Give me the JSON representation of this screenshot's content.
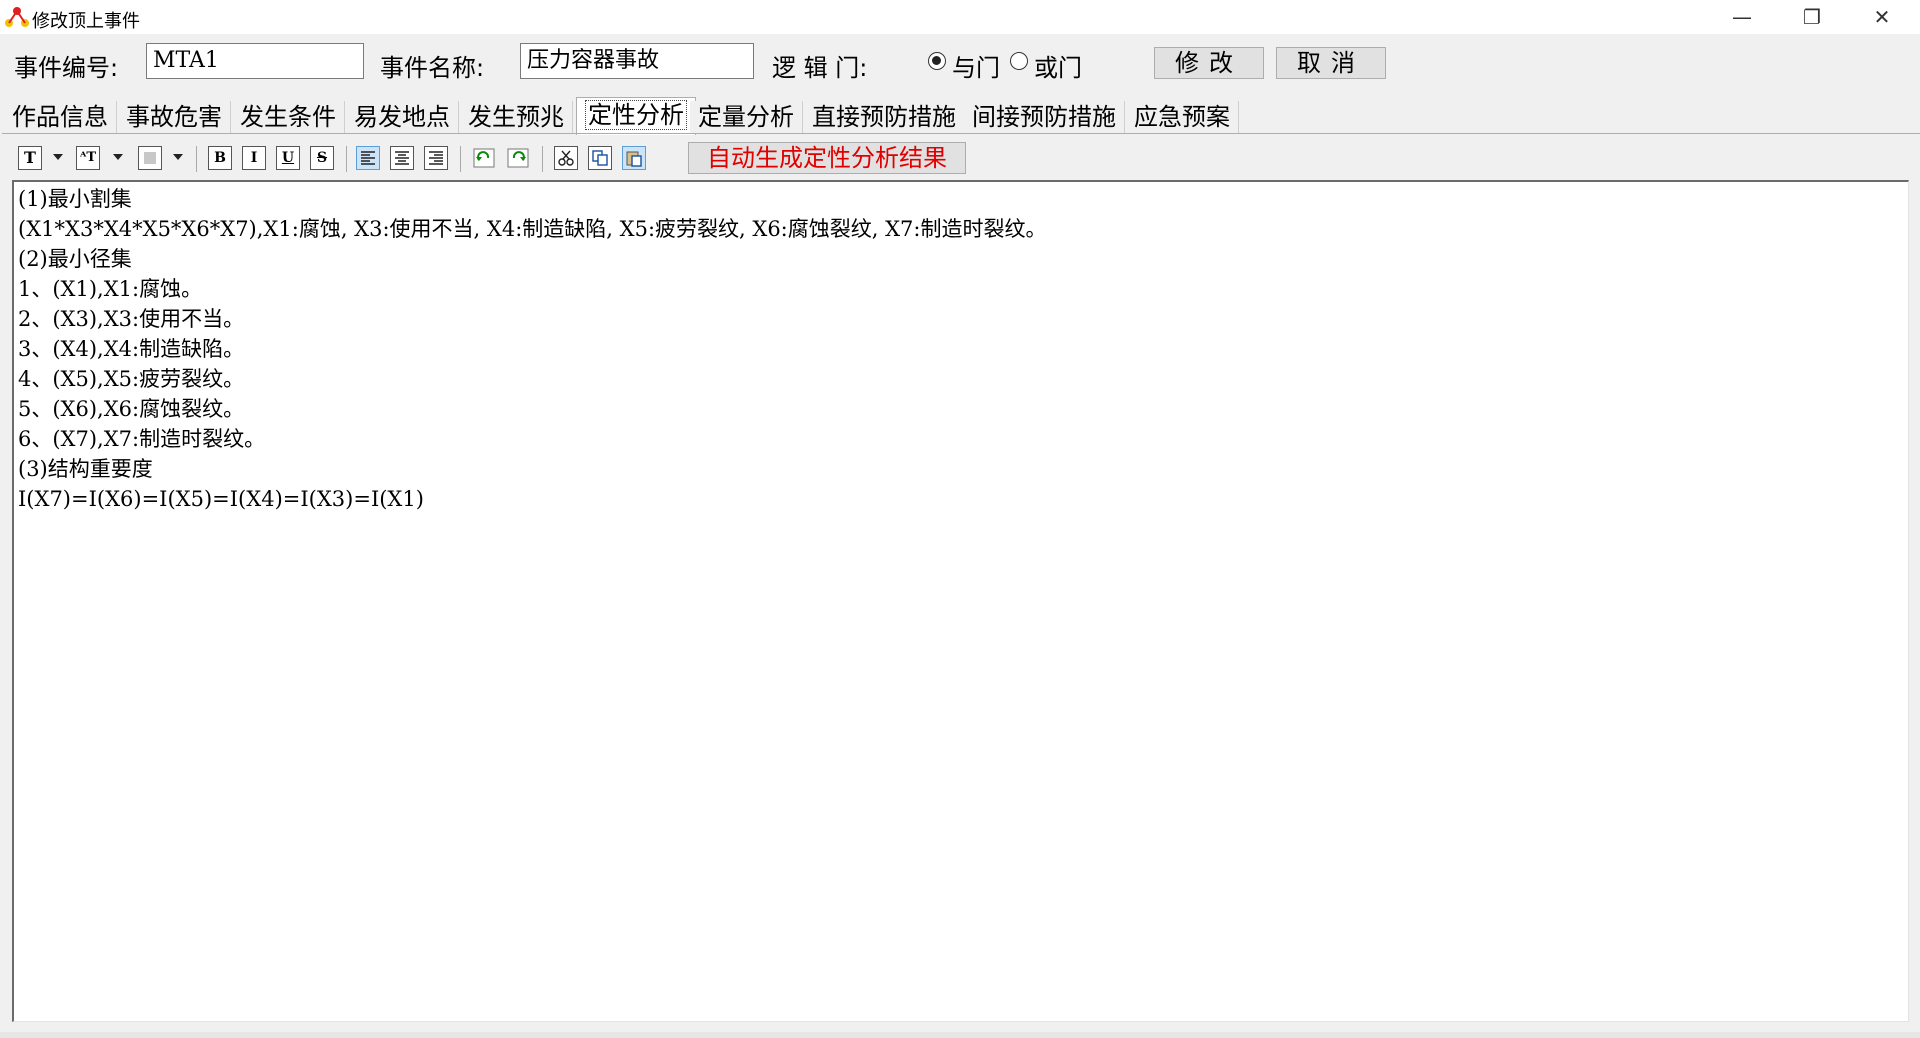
{
  "window": {
    "title": "修改顶上事件",
    "controls": {
      "minimize": "—",
      "maximize": "❐",
      "close": "✕"
    }
  },
  "header": {
    "event_no_label": "事件编号:",
    "event_no_value": "MTA1",
    "event_name_label": "事件名称:",
    "event_name_value": "压力容器事故",
    "logic_gate_label": "逻 辑 门:",
    "gate_and": "与门",
    "gate_or": "或门",
    "selected_gate": "与门",
    "modify_button": "修改",
    "cancel_button": "取消"
  },
  "tabs": [
    "作品信息",
    "事故危害",
    "发生条件",
    "易发地点",
    "发生预兆",
    "定性分析",
    "定量分析",
    "直接预防措施",
    "间接预防措施",
    "应急预案"
  ],
  "active_tab": "定性分析",
  "toolbar": {
    "icons": [
      "font-icon",
      "font-size-icon",
      "color-icon",
      "bold-icon",
      "italic-icon",
      "underline-icon",
      "strikethrough-icon",
      "align-left-icon",
      "align-center-icon",
      "align-right-icon",
      "undo-icon",
      "redo-icon",
      "cut-icon",
      "copy-icon",
      "paste-icon"
    ],
    "generate_button": "自动生成定性分析结果",
    "generate_color": "#e00000"
  },
  "editor": {
    "lines": [
      "(1)最小割集",
      "(X1*X3*X4*X5*X6*X7),X1:腐蚀, X3:使用不当, X4:制造缺陷, X5:疲劳裂纹, X6:腐蚀裂纹, X7:制造时裂纹。",
      "(2)最小径集",
      "1、(X1),X1:腐蚀。",
      "2、(X3),X3:使用不当。",
      "3、(X4),X4:制造缺陷。",
      "4、(X5),X5:疲劳裂纹。",
      "5、(X6),X6:腐蚀裂纹。",
      "6、(X7),X7:制造时裂纹。",
      "(3)结构重要度",
      "I(X7)=I(X6)=I(X5)=I(X4)=I(X3)=I(X1)"
    ]
  }
}
